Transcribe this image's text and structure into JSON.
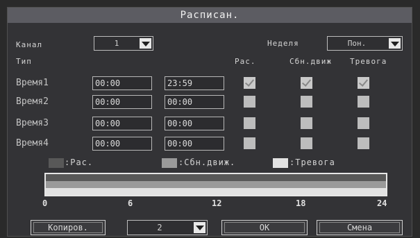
{
  "title": "Расписан.",
  "channel": {
    "label": "Канал",
    "value": "1"
  },
  "week": {
    "label": "Неделя",
    "value": "Пон."
  },
  "type_label": "Тип",
  "columns": {
    "schedule": "Рас.",
    "motion": "Сбн.движ",
    "alarm": "Тревога"
  },
  "rows": [
    {
      "label": "Время1",
      "start": "00:00",
      "end": "23:59",
      "schedule": true,
      "motion": true,
      "alarm": true
    },
    {
      "label": "Время2",
      "start": "00:00",
      "end": "00:00",
      "schedule": false,
      "motion": false,
      "alarm": false
    },
    {
      "label": "Время3",
      "start": "00:00",
      "end": "00:00",
      "schedule": false,
      "motion": false,
      "alarm": false
    },
    {
      "label": "Время4",
      "start": "00:00",
      "end": "00:00",
      "schedule": false,
      "motion": false,
      "alarm": false
    }
  ],
  "legend": {
    "schedule": ":Рас.",
    "motion": ":Сбн.движ.",
    "alarm": ":Тревога"
  },
  "legend_colors": {
    "schedule": "#585858",
    "motion": "#9a9a9a",
    "alarm": "#e2e2e2"
  },
  "timeline": {
    "ticks": [
      "0",
      "6",
      "12",
      "18",
      "24"
    ],
    "schedule_range": [
      0,
      24
    ],
    "motion_range": [
      0,
      24
    ],
    "alarm_range": [
      0,
      24
    ]
  },
  "buttons": {
    "copy": "Копиров.",
    "copy_target": "2",
    "ok": "OK",
    "cancel": "Cмена"
  }
}
